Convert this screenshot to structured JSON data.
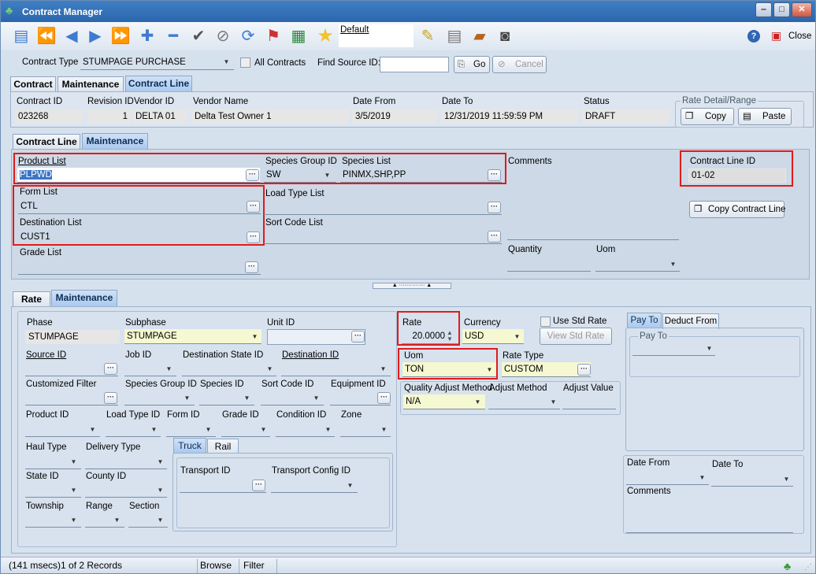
{
  "window": {
    "title": "Contract Manager",
    "close_label": "Close",
    "help_icon": "help-icon",
    "minimize": "‒",
    "maximize": "□",
    "close_x": "✕"
  },
  "toolbar": {
    "default_view": "Default"
  },
  "filter": {
    "contract_type_label": "Contract Type",
    "contract_type_value": "STUMPAGE PURCHASE",
    "all_contracts_label": "All Contracts",
    "find_source_label": "Find Source ID:",
    "find_source_value": "",
    "go_label": "Go",
    "cancel_label": "Cancel"
  },
  "main_tabs": [
    "Contract",
    "Maintenance",
    "Contract Line"
  ],
  "header": {
    "contract_id_label": "Contract ID",
    "contract_id": "023268",
    "revision_id_label": "Revision ID",
    "revision_id": "1",
    "vendor_id_label": "Vendor ID",
    "vendor_id": "DELTA 01",
    "vendor_name_label": "Vendor Name",
    "vendor_name": "Delta Test Owner 1",
    "date_from_label": "Date From",
    "date_from": "3/5/2019",
    "date_to_label": "Date To",
    "date_to": "12/31/2019 11:59:59 PM",
    "status_label": "Status",
    "status": "DRAFT",
    "rate_detail_label": "Rate Detail/Range",
    "copy_label": "Copy",
    "paste_label": "Paste"
  },
  "line_tabs": [
    "Contract Line",
    "Maintenance"
  ],
  "line": {
    "product_list_label": "Product List",
    "product_list": "PLPWD",
    "species_group_label": "Species Group ID",
    "species_group": "SW",
    "species_list_label": "Species List",
    "species_list": "PINMX,SHP,PP",
    "comments_label": "Comments",
    "contract_line_id_label": "Contract Line ID",
    "contract_line_id": "01-02",
    "form_list_label": "Form List",
    "form_list": "CTL",
    "load_type_label": "Load Type List",
    "load_type": "",
    "copy_line_label": "Copy Contract Line",
    "destination_list_label": "Destination List",
    "destination_list": "CUST1",
    "sort_code_label": "Sort Code List",
    "sort_code": "",
    "grade_list_label": "Grade List",
    "grade_list": "",
    "quantity_label": "Quantity",
    "quantity": "",
    "uom_label": "Uom",
    "uom": ""
  },
  "rate_tabs": [
    "Rate",
    "Maintenance"
  ],
  "rate": {
    "phase_label": "Phase",
    "phase": "STUMPAGE",
    "subphase_label": "Subphase",
    "subphase": "STUMPAGE",
    "unit_id_label": "Unit ID",
    "unit_id": "",
    "rate_label": "Rate",
    "rate": "20.0000",
    "currency_label": "Currency",
    "currency": "USD",
    "use_std_rate_label": "Use Std Rate",
    "view_std_rate_label": "View Std Rate",
    "source_id_label": "Source ID",
    "job_id_label": "Job ID",
    "dest_state_label": "Destination State ID",
    "destination_id_label": "Destination ID",
    "uom_label": "Uom",
    "uom": "TON",
    "rate_type_label": "Rate Type",
    "rate_type": "CUSTOM",
    "custom_filter_label": "Customized Filter",
    "species_group_label": "Species Group ID",
    "species_id_label": "Species ID",
    "sort_code_label": "Sort Code ID",
    "equipment_label": "Equipment ID",
    "quality_adj_label": "Quality Adjust Method",
    "quality_adj": "N/A",
    "adjust_method_label": "Adjust Method",
    "adjust_value_label": "Adjust Value",
    "product_id_label": "Product ID",
    "load_type_label": "Load Type ID",
    "form_id_label": "Form ID",
    "grade_id_label": "Grade ID",
    "condition_label": "Condition ID",
    "zone_label": "Zone",
    "haul_type_label": "Haul Type",
    "delivery_type_label": "Delivery Type",
    "state_label": "State ID",
    "county_label": "County ID",
    "township_label": "Township",
    "range_label": "Range",
    "section_label": "Section",
    "transport_tabs": [
      "Truck",
      "Rail"
    ],
    "transport_id_label": "Transport ID",
    "transport_config_label": "Transport Config ID",
    "pay_tabs": [
      "Pay To",
      "Deduct From"
    ],
    "pay_to_label": "Pay To",
    "date_from_label": "Date From",
    "date_to_label": "Date To",
    "comments_label": "Comments"
  },
  "status_bar": {
    "records": "(141 msecs)1 of 2 Records",
    "browse": "Browse",
    "filter": "Filter"
  }
}
